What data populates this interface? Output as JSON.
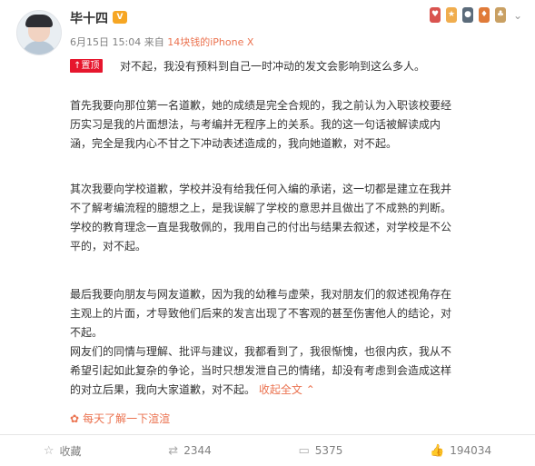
{
  "post": {
    "username": "毕十四",
    "vip_label": "V",
    "meta": {
      "date_time": "6月15日 15:04",
      "from_label": "来自",
      "source": "14块钱的iPhone X"
    },
    "pin_label": "置顶",
    "pin_text": "对不起，我没有预料到自己一时冲动的发文会影响到这么多人。",
    "paragraphs": [
      [
        "首先我要向那位第一名道歉，她的成绩是完全合规的，我之前认为入职该校要经",
        "历实习是我的片面想法，与考编并无程序上的关系。我的这一句话被解读成内",
        "涵，完全是我内心不甘之下冲动表述造成的，我向她道歉，对不起。"
      ],
      [
        "其次我要向学校道歉，学校并没有给我任何入编的承诺，这一切都是建立在我并",
        "不了解考编流程的臆想之上，是我误解了学校的意思并且做出了不成熟的判断。",
        "学校的教育理念一直是我敬佩的，我用自己的付出与结果去叙述，对学校是不公",
        "平的，对不起。"
      ],
      [
        "最后我要向朋友与网友道歉，因为我的幼稚与虚荣，我对朋友们的叙述视角存在",
        "主观上的片面，才导致他们后来的发言出现了不客观的甚至伤害他人的结论，对",
        "不起。",
        "网友们的同情与理解、批评与建议，我都看到了，我很惭愧，也很内疚，我从不",
        "希望引起如此复杂的争论，当时只想发泄自己的情绪，却没有考虑到会造成这样",
        "的对立后果，我向大家道歉，对不起。"
      ]
    ],
    "collapse_label": "收起全文",
    "collapse_arrow": "⌃",
    "daily_link": "每天了解一下渲渲"
  },
  "actions": {
    "favorite_label": "收藏",
    "repost_count": "2344",
    "comment_count": "5375",
    "like_count": "194034"
  },
  "colors": {
    "accent": "#eb7350",
    "pin_red": "#e6162d",
    "vip_gold": "#f6a623"
  }
}
